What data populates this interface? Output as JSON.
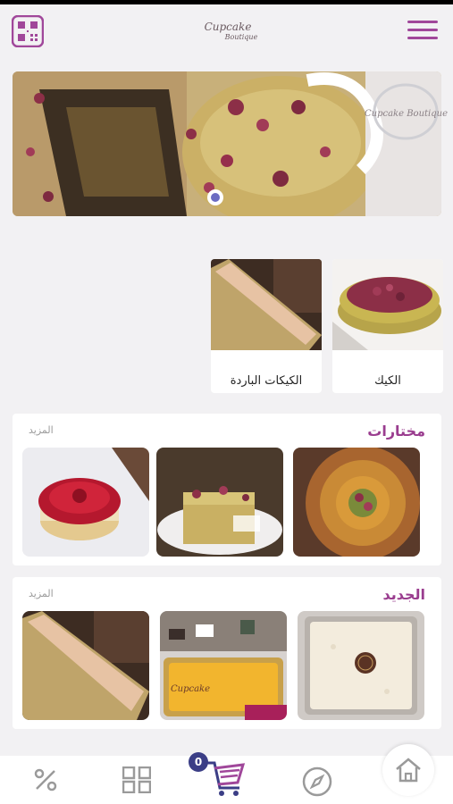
{
  "header": {
    "logo_line1": "Cupcake",
    "logo_line2": "Boutique",
    "banner_brand": "Cupcake Boutique"
  },
  "categories": [
    {
      "label": "الكيك",
      "icon": "cake-photo"
    },
    {
      "label": "الكيكات الباردة",
      "icon": "cold-cake-photo"
    }
  ],
  "featured": {
    "title": "مختارات",
    "more_label": "المزيد"
  },
  "new_items": {
    "title": "الجديد",
    "more_label": "المزيد",
    "tile_brand": "Cupcake"
  },
  "bottom_nav": {
    "cart_count": "0",
    "items": [
      "home-icon",
      "compass-icon",
      "cart-icon",
      "grid-icon",
      "percent-icon"
    ]
  },
  "colors": {
    "accent": "#a0479a",
    "title": "#9a3d8f",
    "badge": "#3b3e86"
  }
}
